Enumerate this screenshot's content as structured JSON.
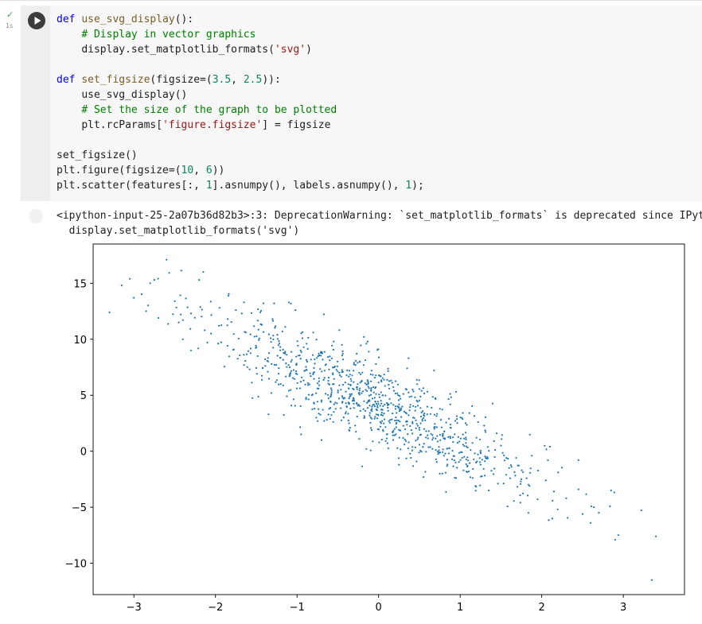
{
  "cell": {
    "exec_time": "1s",
    "check_icon": "check-icon",
    "run_icon": "play-icon"
  },
  "code": {
    "l1_def": "def",
    "l1_fn": "use_svg_display",
    "l1_rest": "():",
    "l2_comment": "# Display in vector graphics",
    "l3_a": "display.set_matplotlib_formats(",
    "l3_str": "'svg'",
    "l3_b": ")",
    "l4_def": "def",
    "l4_fn": "set_figsize",
    "l4_a": "(figsize=(",
    "l4_n1": "3.5",
    "l4_c": ", ",
    "l4_n2": "2.5",
    "l4_b": ")):",
    "l5": "use_svg_display()",
    "l6_comment": "# Set the size of the graph to be plotted",
    "l7_a": "plt.rcParams[",
    "l7_str": "'figure.figsize'",
    "l7_b": "] = figsize",
    "l8": "set_figsize()",
    "l9_a": "plt.figure(figsize=(",
    "l9_n1": "10",
    "l9_c": ", ",
    "l9_n2": "6",
    "l9_b": "))",
    "l10_a": "plt.scatter(features[:, ",
    "l10_n1": "1",
    "l10_b": "].asnumpy(), labels.asnumpy(), ",
    "l10_n2": "1",
    "l10_c": ");"
  },
  "output": {
    "warning_line1": "<ipython-input-25-2a07b36d82b3>:3: DeprecationWarning: `set_matplotlib_formats` is deprecated since IPytho",
    "warning_line2": "  display.set_matplotlib_formats('svg')"
  },
  "chart_data": {
    "type": "scatter",
    "title": "",
    "xlabel": "",
    "ylabel": "",
    "xlim": [
      -3.5,
      3.75
    ],
    "ylim": [
      -12.8,
      18.5
    ],
    "xticks": [
      -3,
      -2,
      -1,
      0,
      1,
      2,
      3
    ],
    "yticks": [
      -10,
      -5,
      0,
      5,
      10,
      15
    ],
    "xtick_labels": [
      "−3",
      "−2",
      "−1",
      "0",
      "1",
      "2",
      "3"
    ],
    "ytick_labels": [
      "−10",
      "−5",
      "0",
      "5",
      "10",
      "15"
    ],
    "grid": false,
    "point_color": "#1f77b4",
    "n_points": 1000,
    "trend": {
      "slope": -3.4,
      "intercept": 4.2,
      "noise_sd": 1.9
    },
    "points": [
      [
        -3.3,
        12.4
      ],
      [
        -3.15,
        14.8
      ],
      [
        -3.05,
        15.4
      ],
      [
        -3.0,
        13.7
      ],
      [
        -2.85,
        12.5
      ],
      [
        -2.8,
        15.0
      ],
      [
        -2.75,
        15.3
      ],
      [
        -2.7,
        11.9
      ],
      [
        -2.6,
        17.1
      ],
      [
        -2.5,
        13.4
      ],
      [
        -2.45,
        11.5
      ],
      [
        -2.4,
        10.0
      ],
      [
        -2.3,
        12.3
      ],
      [
        -2.2,
        15.3
      ],
      [
        -2.15,
        16.0
      ],
      [
        -1.95,
        12.8
      ],
      [
        -1.85,
        11.8
      ],
      [
        -1.75,
        12.6
      ],
      [
        -1.65,
        13.3
      ],
      [
        -1.45,
        12.4
      ],
      [
        -1.3,
        11.8
      ],
      [
        -1.1,
        13.3
      ],
      [
        -1.02,
        12.6
      ],
      [
        -0.55,
        9.8
      ],
      [
        -0.45,
        9.5
      ],
      [
        -0.18,
        10.2
      ],
      [
        0.05,
        5.0
      ],
      [
        0.35,
        7.4
      ],
      [
        0.68,
        7.2
      ],
      [
        0.95,
        5.3
      ],
      [
        1.2,
        1.2
      ],
      [
        1.5,
        0.5
      ],
      [
        1.6,
        -1.5
      ],
      [
        1.75,
        -2.5
      ],
      [
        1.85,
        -3.1
      ],
      [
        1.95,
        -4.3
      ],
      [
        2.05,
        -2.6
      ],
      [
        2.15,
        -3.6
      ],
      [
        2.3,
        -4.2
      ],
      [
        2.45,
        -3.4
      ],
      [
        2.5,
        -5.6
      ],
      [
        2.6,
        -6.4
      ],
      [
        2.7,
        -5.5
      ],
      [
        2.85,
        -3.5
      ],
      [
        2.9,
        -7.9
      ],
      [
        3.35,
        -11.5
      ],
      [
        3.4,
        -7.6
      ],
      [
        2.45,
        -0.8
      ],
      [
        2.1,
        0.4
      ],
      [
        1.35,
        -3.5
      ],
      [
        -0.35,
        2.1
      ],
      [
        -0.4,
        3.5
      ],
      [
        -0.15,
        0.2
      ],
      [
        0.75,
        -2.0
      ],
      [
        0.95,
        -2.4
      ],
      [
        -0.95,
        1.5
      ],
      [
        -0.7,
        1.0
      ],
      [
        -1.35,
        3.3
      ],
      [
        -2.3,
        9.0
      ],
      [
        -2.1,
        9.7
      ],
      [
        -1.65,
        7.7
      ],
      [
        -1.2,
        6.0
      ],
      [
        -0.8,
        7.0
      ],
      [
        -0.3,
        7.9
      ],
      [
        0.25,
        -1.2
      ],
      [
        0.55,
        -2.3
      ],
      [
        1.05,
        -0.5
      ],
      [
        1.25,
        -1.2
      ],
      [
        0.1,
        1.5
      ],
      [
        -0.05,
        2.9
      ]
    ]
  }
}
